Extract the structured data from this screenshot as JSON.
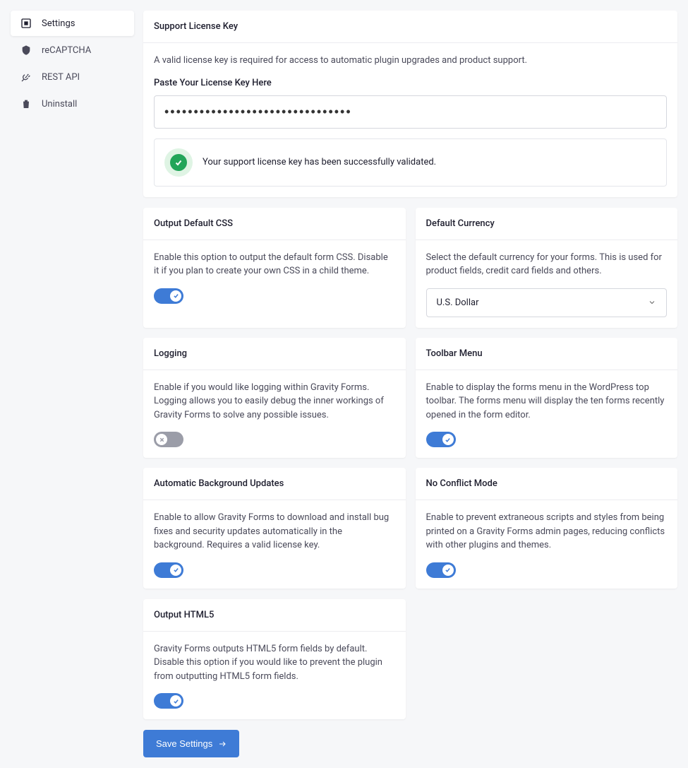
{
  "sidebar": {
    "items": [
      {
        "label": "Settings"
      },
      {
        "label": "reCAPTCHA"
      },
      {
        "label": "REST API"
      },
      {
        "label": "Uninstall"
      }
    ]
  },
  "license": {
    "header": "Support License Key",
    "desc": "A valid license key is required for access to automatic plugin upgrades and product support.",
    "label": "Paste Your License Key Here",
    "value": "••••••••••••••••••••••••••••••••",
    "success_msg": "Your support license key has been successfully validated."
  },
  "output_css": {
    "header": "Output Default CSS",
    "desc": "Enable this option to output the default form CSS. Disable it if you plan to create your own CSS in a child theme."
  },
  "currency": {
    "header": "Default Currency",
    "desc": "Select the default currency for your forms. This is used for product fields, credit card fields and others.",
    "selected": "U.S. Dollar"
  },
  "logging": {
    "header": "Logging",
    "desc": "Enable if you would like logging within Gravity Forms. Logging allows you to easily debug the inner workings of Gravity Forms to solve any possible issues."
  },
  "toolbar": {
    "header": "Toolbar Menu",
    "desc": "Enable to display the forms menu in the WordPress top toolbar. The forms menu will display the ten forms recently opened in the form editor."
  },
  "updates": {
    "header": "Automatic Background Updates",
    "desc": "Enable to allow Gravity Forms to download and install bug fixes and security updates automatically in the background. Requires a valid license key."
  },
  "noconflict": {
    "header": "No Conflict Mode",
    "desc": "Enable to prevent extraneous scripts and styles from being printed on a Gravity Forms admin pages, reducing conflicts with other plugins and themes."
  },
  "html5": {
    "header": "Output HTML5",
    "desc": "Gravity Forms outputs HTML5 form fields by default. Disable this option if you would like to prevent the plugin from outputting HTML5 form fields."
  },
  "save_button": "Save Settings"
}
